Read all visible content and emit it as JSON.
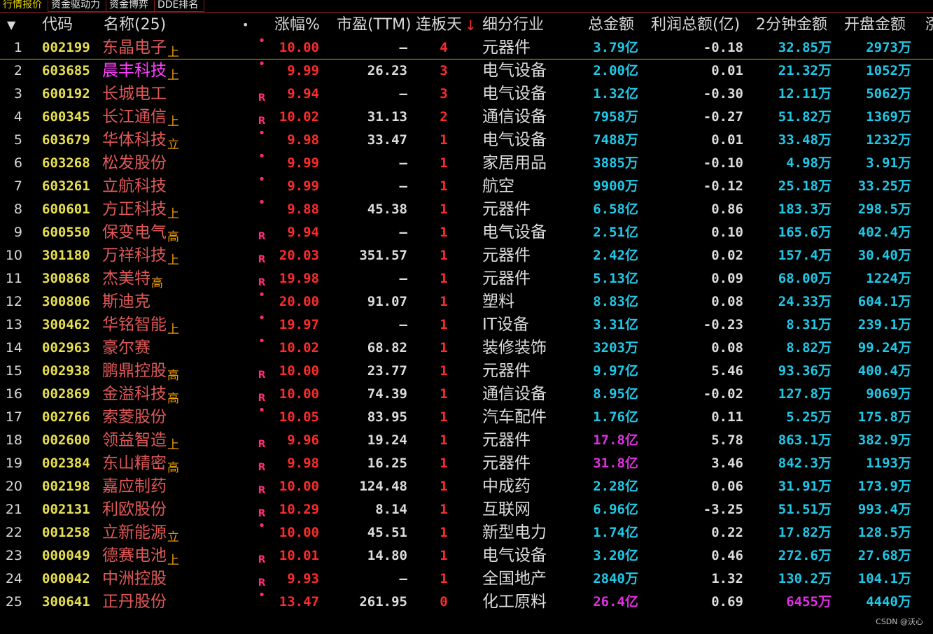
{
  "tabs": [
    "行情报价",
    "资金驱动力",
    "资金博弈",
    "DDE排名"
  ],
  "header": {
    "sort_icon": "▼",
    "code": "代码",
    "name": "名称(25)",
    "dot": "•",
    "change": "涨幅%",
    "pe": "市盈(TTM)",
    "limit_days": "连板天",
    "sort_arrow": "↓",
    "industry": "细分行业",
    "amount": "总金额",
    "profit": "利润总额(亿)",
    "amount2m": "2分钟金额",
    "open_amount": "开盘金额",
    "more": "涨"
  },
  "rows": [
    {
      "idx": "1",
      "code": "002199",
      "name": "东晶电子",
      "tag": "上",
      "mark": "•",
      "change": "10.00",
      "pe": "—",
      "days": "4",
      "industry": "元器件",
      "amount": "3.79亿",
      "profit": "-0.18",
      "a2": "32.85万",
      "open": "2973万"
    },
    {
      "idx": "2",
      "code": "603685",
      "name": "晨丰科技",
      "tag": "上",
      "mark": "•",
      "change": "9.99",
      "pe": "26.23",
      "days": "3",
      "industry": "电气设备",
      "amount": "2.00亿",
      "profit": "0.01",
      "a2": "21.32万",
      "open": "1052万"
    },
    {
      "idx": "3",
      "code": "600192",
      "name": "长城电工",
      "tag": "",
      "mark": "R",
      "change": "9.94",
      "pe": "—",
      "days": "3",
      "industry": "电气设备",
      "amount": "1.32亿",
      "profit": "-0.30",
      "a2": "12.11万",
      "open": "5062万"
    },
    {
      "idx": "4",
      "code": "600345",
      "name": "长江通信",
      "tag": "上",
      "mark": "R",
      "change": "10.02",
      "pe": "31.13",
      "days": "2",
      "industry": "通信设备",
      "amount": "7958万",
      "profit": "-0.27",
      "a2": "51.82万",
      "open": "1369万"
    },
    {
      "idx": "5",
      "code": "603679",
      "name": "华体科技",
      "tag": "立",
      "mark": "•",
      "change": "9.98",
      "pe": "33.47",
      "days": "1",
      "industry": "电气设备",
      "amount": "7488万",
      "profit": "0.01",
      "a2": "33.48万",
      "open": "1232万"
    },
    {
      "idx": "6",
      "code": "603268",
      "name": "松发股份",
      "tag": "",
      "mark": "•",
      "change": "9.99",
      "pe": "—",
      "days": "1",
      "industry": "家居用品",
      "amount": "3885万",
      "profit": "-0.10",
      "a2": "4.98万",
      "open": "3.91万"
    },
    {
      "idx": "7",
      "code": "603261",
      "name": "立航科技",
      "tag": "",
      "mark": "•",
      "change": "9.99",
      "pe": "—",
      "days": "1",
      "industry": "航空",
      "amount": "9900万",
      "profit": "-0.12",
      "a2": "25.18万",
      "open": "33.25万"
    },
    {
      "idx": "8",
      "code": "600601",
      "name": "方正科技",
      "tag": "上",
      "mark": "•",
      "change": "9.88",
      "pe": "45.38",
      "days": "1",
      "industry": "元器件",
      "amount": "6.58亿",
      "profit": "0.86",
      "a2": "183.3万",
      "open": "298.5万"
    },
    {
      "idx": "9",
      "code": "600550",
      "name": "保变电气",
      "tag": "高",
      "mark": "R",
      "change": "9.94",
      "pe": "—",
      "days": "1",
      "industry": "电气设备",
      "amount": "2.51亿",
      "profit": "0.10",
      "a2": "165.6万",
      "open": "402.4万"
    },
    {
      "idx": "10",
      "code": "301180",
      "name": "万祥科技",
      "tag": "上",
      "mark": "R",
      "change": "20.03",
      "pe": "351.57",
      "days": "1",
      "industry": "元器件",
      "amount": "2.42亿",
      "profit": "0.02",
      "a2": "157.4万",
      "open": "30.40万"
    },
    {
      "idx": "11",
      "code": "300868",
      "name": "杰美特",
      "tag": "高",
      "mark": "R",
      "change": "19.98",
      "pe": "—",
      "days": "1",
      "industry": "元器件",
      "amount": "5.13亿",
      "profit": "0.09",
      "a2": "68.00万",
      "open": "1224万"
    },
    {
      "idx": "12",
      "code": "300806",
      "name": "斯迪克",
      "tag": "",
      "mark": "•",
      "change": "20.00",
      "pe": "91.07",
      "days": "1",
      "industry": "塑料",
      "amount": "8.83亿",
      "profit": "0.08",
      "a2": "24.33万",
      "open": "604.1万"
    },
    {
      "idx": "13",
      "code": "300462",
      "name": "华铭智能",
      "tag": "上",
      "mark": "•",
      "change": "19.97",
      "pe": "—",
      "days": "1",
      "industry": "IT设备",
      "amount": "3.31亿",
      "profit": "-0.23",
      "a2": "8.31万",
      "open": "239.1万"
    },
    {
      "idx": "14",
      "code": "002963",
      "name": "豪尔赛",
      "tag": "",
      "mark": "•",
      "change": "10.02",
      "pe": "68.82",
      "days": "1",
      "industry": "装修装饰",
      "amount": "3203万",
      "profit": "0.08",
      "a2": "8.82万",
      "open": "99.24万"
    },
    {
      "idx": "15",
      "code": "002938",
      "name": "鹏鼎控股",
      "tag": "高",
      "mark": "R",
      "change": "10.00",
      "pe": "23.77",
      "days": "1",
      "industry": "元器件",
      "amount": "9.97亿",
      "profit": "5.46",
      "a2": "93.36万",
      "open": "400.4万"
    },
    {
      "idx": "16",
      "code": "002869",
      "name": "金溢科技",
      "tag": "高",
      "mark": "R",
      "change": "10.00",
      "pe": "74.39",
      "days": "1",
      "industry": "通信设备",
      "amount": "8.95亿",
      "profit": "-0.02",
      "a2": "127.8万",
      "open": "9069万"
    },
    {
      "idx": "17",
      "code": "002766",
      "name": "索菱股份",
      "tag": "",
      "mark": "•",
      "change": "10.05",
      "pe": "83.95",
      "days": "1",
      "industry": "汽车配件",
      "amount": "1.76亿",
      "profit": "0.11",
      "a2": "5.25万",
      "open": "175.8万"
    },
    {
      "idx": "18",
      "code": "002600",
      "name": "领益智造",
      "tag": "上",
      "mark": "R",
      "change": "9.96",
      "pe": "19.24",
      "days": "1",
      "industry": "元器件",
      "amount": "17.8亿",
      "profit": "5.78",
      "a2": "863.1万",
      "open": "382.9万"
    },
    {
      "idx": "19",
      "code": "002384",
      "name": "东山精密",
      "tag": "高",
      "mark": "R",
      "change": "9.98",
      "pe": "16.25",
      "days": "1",
      "industry": "元器件",
      "amount": "31.8亿",
      "profit": "3.46",
      "a2": "842.3万",
      "open": "1193万"
    },
    {
      "idx": "20",
      "code": "002198",
      "name": "嘉应制药",
      "tag": "",
      "mark": "R",
      "change": "10.00",
      "pe": "124.48",
      "days": "1",
      "industry": "中成药",
      "amount": "2.28亿",
      "profit": "0.06",
      "a2": "31.91万",
      "open": "173.9万"
    },
    {
      "idx": "21",
      "code": "002131",
      "name": "利欧股份",
      "tag": "",
      "mark": "R",
      "change": "10.29",
      "pe": "8.14",
      "days": "1",
      "industry": "互联网",
      "amount": "6.96亿",
      "profit": "-3.25",
      "a2": "51.51万",
      "open": "993.4万"
    },
    {
      "idx": "22",
      "code": "001258",
      "name": "立新能源",
      "tag": "立",
      "mark": "•",
      "change": "10.00",
      "pe": "45.51",
      "days": "1",
      "industry": "新型电力",
      "amount": "1.74亿",
      "profit": "0.22",
      "a2": "17.82万",
      "open": "128.5万"
    },
    {
      "idx": "23",
      "code": "000049",
      "name": "德赛电池",
      "tag": "上",
      "mark": "R",
      "change": "10.01",
      "pe": "14.80",
      "days": "1",
      "industry": "电气设备",
      "amount": "3.20亿",
      "profit": "0.46",
      "a2": "272.6万",
      "open": "27.68万"
    },
    {
      "idx": "24",
      "code": "000042",
      "name": "中洲控股",
      "tag": "",
      "mark": "R",
      "change": "9.93",
      "pe": "—",
      "days": "1",
      "industry": "全国地产",
      "amount": "2840万",
      "profit": "1.32",
      "a2": "130.2万",
      "open": "104.1万"
    },
    {
      "idx": "25",
      "code": "300641",
      "name": "正丹股份",
      "tag": "",
      "mark": "•",
      "change": "13.47",
      "pe": "261.95",
      "days": "0",
      "industry": "化工原料",
      "amount": "26.4亿",
      "profit": "0.69",
      "a2": "6455万",
      "open": "4440万"
    }
  ],
  "colors": {
    "background": "#000000",
    "rise": "#ff2a2a",
    "code": "#e8e050",
    "amount": "#20c8e8",
    "highlight": "#e030e0",
    "tag": "#f0a000"
  },
  "watermark": "CSDN @沃心"
}
